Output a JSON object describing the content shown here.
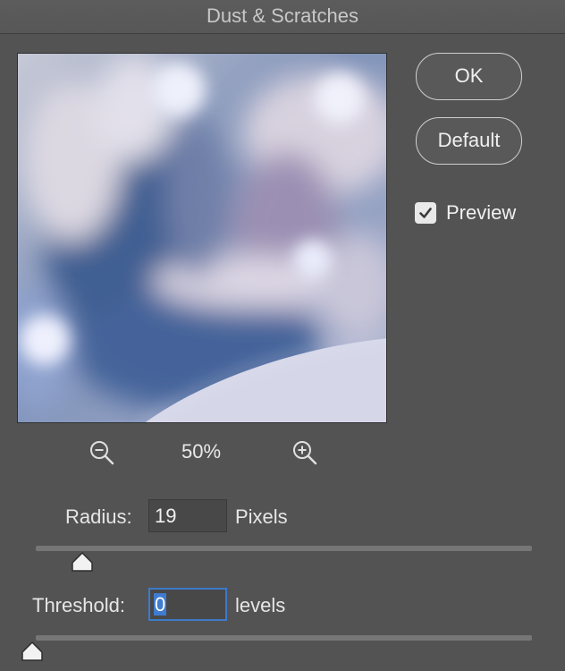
{
  "dialog": {
    "title": "Dust & Scratches"
  },
  "buttons": {
    "ok_label": "OK",
    "default_label": "Default"
  },
  "preview": {
    "label": "Preview",
    "checked": true,
    "zoom_level": "50%",
    "zoom_out_icon": "zoom-out-icon",
    "zoom_in_icon": "zoom-in-icon"
  },
  "radius": {
    "label": "Radius:",
    "value": "19",
    "unit": "Pixels",
    "slider_fraction": 0.095
  },
  "threshold": {
    "label": "Threshold:",
    "value": "0",
    "unit": "levels",
    "slider_fraction": 0.0
  },
  "colors": {
    "background": "#535353",
    "accent": "#3f7bd0"
  }
}
